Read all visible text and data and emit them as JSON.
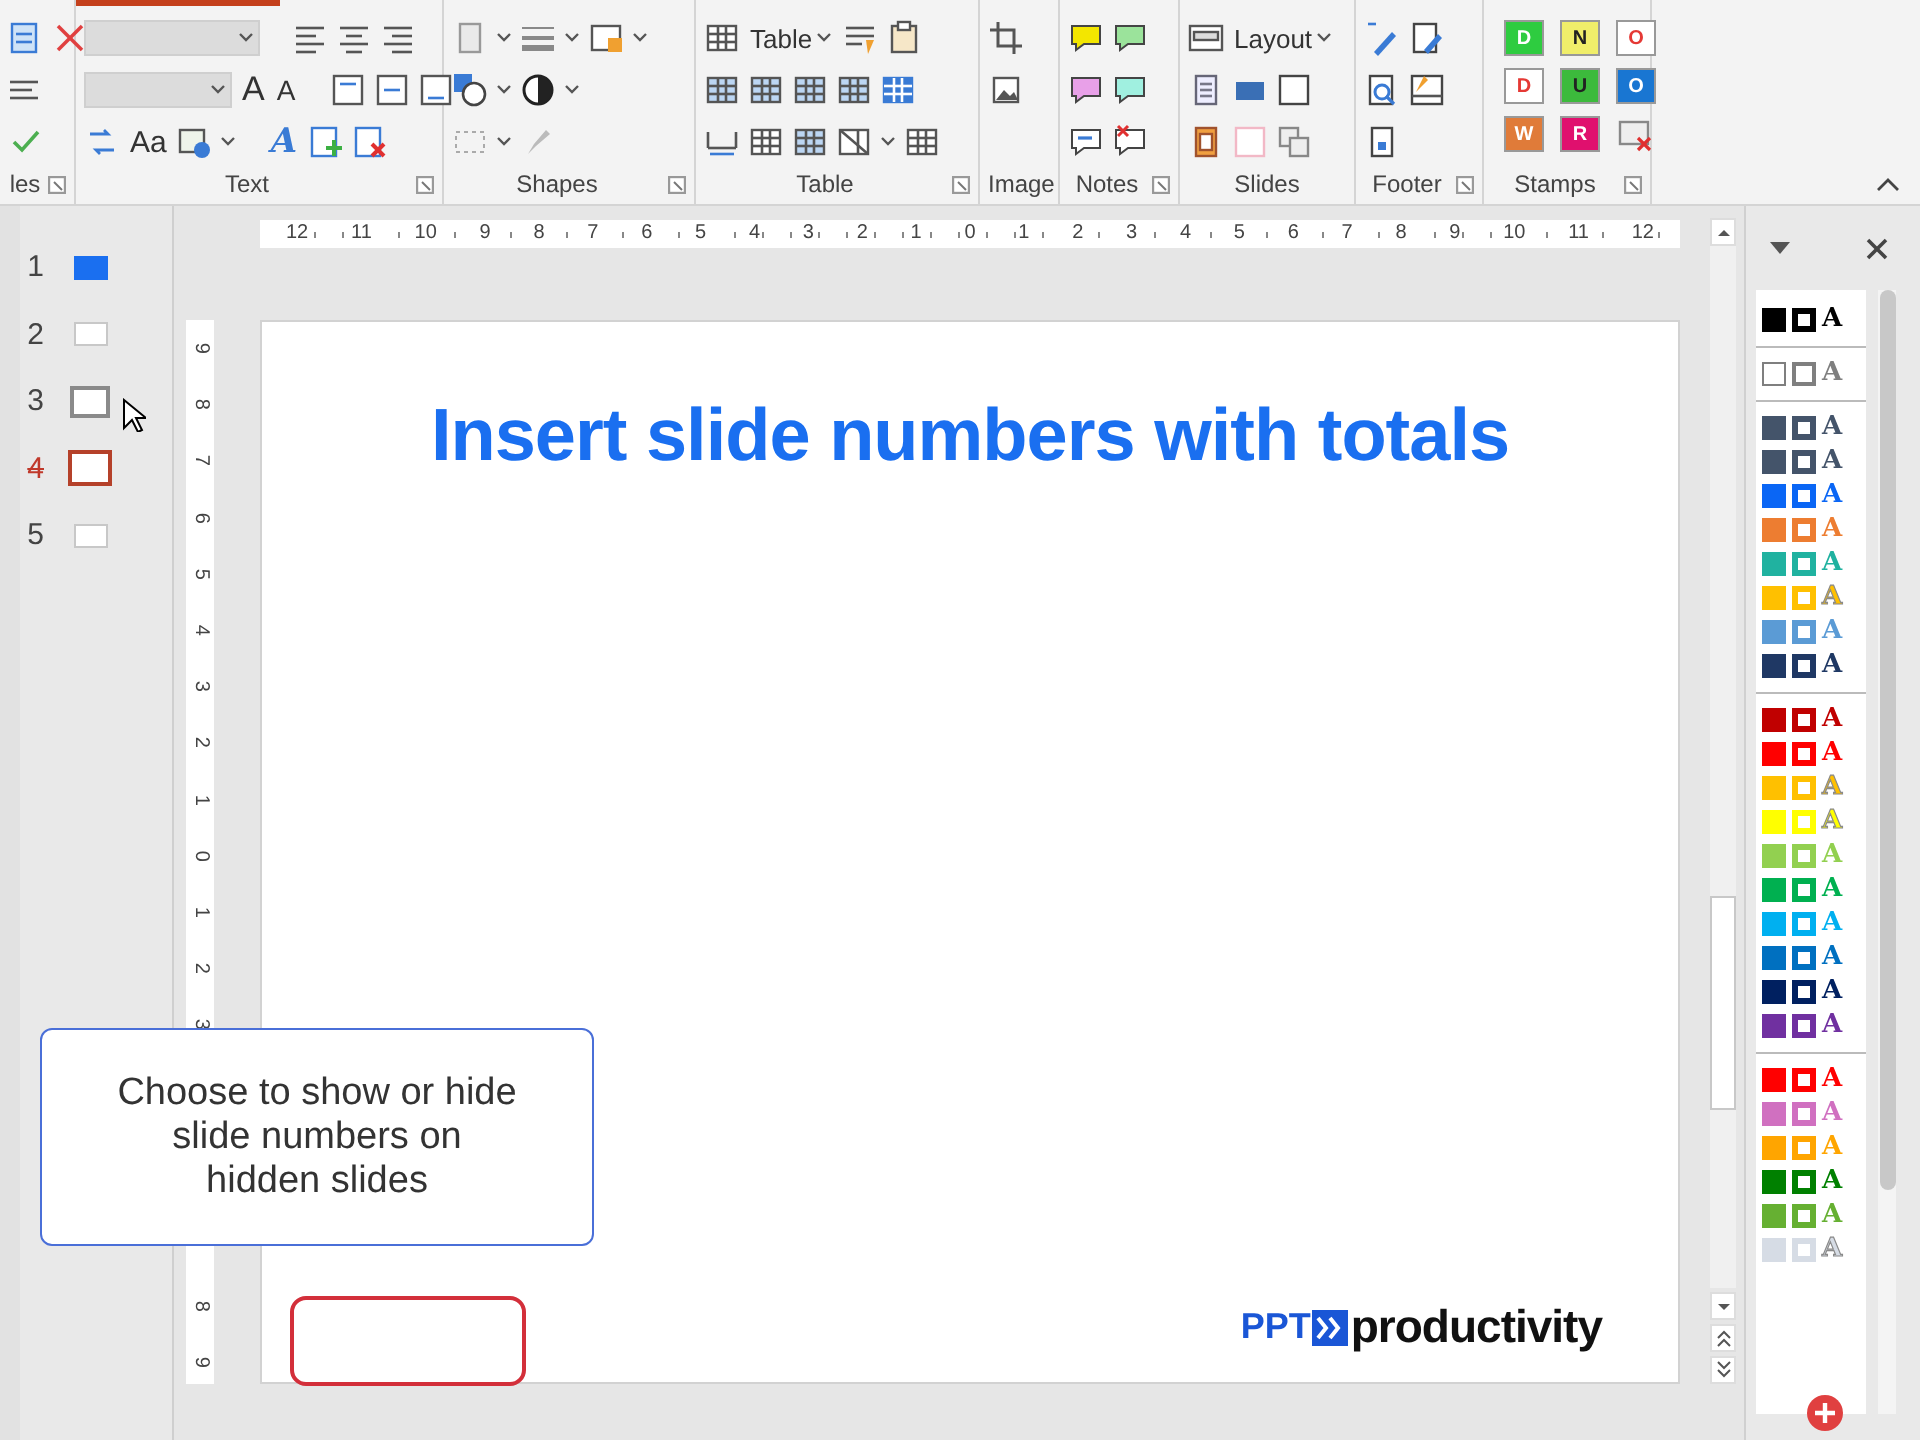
{
  "ribbon": {
    "groups": [
      {
        "kind": "styles",
        "title": "les",
        "launcher": true
      },
      {
        "kind": "text",
        "title": "Text",
        "launcher": true,
        "fields": [
          {
            "kind": "font",
            "disabled": true
          },
          {
            "kind": "size",
            "disabled": true
          }
        ],
        "labels": [
          {
            "text": "A",
            "kind": "grow"
          },
          {
            "text": "A",
            "kind": "shrink"
          },
          {
            "text": "Aa",
            "kind": "case"
          },
          {
            "text": "A",
            "kind": "effect"
          }
        ]
      },
      {
        "kind": "shapes",
        "title": "Shapes",
        "launcher": true
      },
      {
        "kind": "table",
        "title": "Table",
        "launcher": true,
        "labels": [
          {
            "text": "Table",
            "kind": "table"
          }
        ]
      },
      {
        "kind": "image",
        "title": "Image",
        "launcher": false
      },
      {
        "kind": "notes",
        "title": "Notes",
        "launcher": true
      },
      {
        "kind": "slides",
        "title": "Slides",
        "launcher": false,
        "labels": [
          {
            "text": "Layout",
            "kind": "layout"
          }
        ]
      },
      {
        "kind": "footer",
        "title": "Footer",
        "launcher": true
      },
      {
        "kind": "stamps",
        "title": "Stamps",
        "launcher": true,
        "stamps": [
          {
            "letter": "D",
            "color": "#2ecc40",
            "kind": "filled"
          },
          {
            "letter": "N",
            "color": "#f0ee6a",
            "kind": "light"
          },
          {
            "letter": "O",
            "color": "#e53935",
            "kind": "outline"
          },
          {
            "letter": "D",
            "color": "#e53935",
            "kind": "outline"
          },
          {
            "letter": "U",
            "color": "#3cba3c",
            "kind": "light"
          },
          {
            "letter": "O",
            "color": "#1976d2",
            "kind": "filled"
          },
          {
            "letter": "W",
            "color": "#e07b39",
            "kind": "filled"
          },
          {
            "letter": "R",
            "color": "#e0106e",
            "kind": "filled"
          }
        ]
      }
    ]
  },
  "thumbnails": [
    {
      "number": "1",
      "kind": "title",
      "selected": false,
      "hidden": false,
      "hovered": false
    },
    {
      "number": "2",
      "kind": "blank",
      "selected": false,
      "hidden": false,
      "hovered": false
    },
    {
      "number": "3",
      "kind": "blank",
      "selected": false,
      "hidden": false,
      "hovered": true
    },
    {
      "number": "4",
      "kind": "blank",
      "selected": true,
      "hidden": true,
      "hovered": false
    },
    {
      "number": "5",
      "kind": "blank",
      "selected": false,
      "hidden": false,
      "hovered": false
    }
  ],
  "rulers": {
    "horizontal": [
      "12",
      "11",
      "10",
      "9",
      "8",
      "7",
      "6",
      "5",
      "4",
      "3",
      "2",
      "1",
      "0",
      "1",
      "2",
      "3",
      "4",
      "5",
      "6",
      "7",
      "8",
      "9",
      "10",
      "11",
      "12"
    ],
    "vertical": [
      [
        "9",
        "8",
        "7",
        "6",
        "5",
        "4",
        "3",
        "2",
        "1",
        "0",
        "1",
        "2",
        "3"
      ],
      [
        "8",
        "9"
      ]
    ]
  },
  "slide": {
    "title": "Insert slide numbers with totals",
    "logo": {
      "prefix": "PPT",
      "name": "productivity"
    }
  },
  "callout": {
    "text": "Choose to show or hide\nslide numbers on\nhidden slides"
  },
  "color_panel": {
    "rows": [
      {
        "kind": "swatch",
        "color": "#000000",
        "letter": "A"
      },
      {
        "kind": "divider"
      },
      {
        "kind": "outline",
        "color": "#7f7f7f",
        "letter": "A"
      },
      {
        "kind": "divider"
      },
      {
        "kind": "swatch",
        "color": "#44546a",
        "letter": "A"
      },
      {
        "kind": "swatch",
        "color": "#44546a",
        "letter": "A"
      },
      {
        "kind": "swatch",
        "color": "#0a66f5",
        "letter": "A"
      },
      {
        "kind": "swatch",
        "color": "#ed7d31",
        "letter": "A"
      },
      {
        "kind": "swatch",
        "color": "#20b2a0",
        "letter": "A"
      },
      {
        "kind": "swatch",
        "color": "#ffc000",
        "letter": "A"
      },
      {
        "kind": "swatch",
        "color": "#5b9bd5",
        "letter": "A"
      },
      {
        "kind": "swatch",
        "color": "#1f3864",
        "letter": "A"
      },
      {
        "kind": "divider"
      },
      {
        "kind": "swatch",
        "color": "#c00000",
        "letter": "A"
      },
      {
        "kind": "swatch",
        "color": "#ff0000",
        "letter": "A"
      },
      {
        "kind": "swatch",
        "color": "#ffc000",
        "letter": "A"
      },
      {
        "kind": "swatch",
        "color": "#ffff00",
        "letter": "A"
      },
      {
        "kind": "swatch",
        "color": "#92d050",
        "letter": "A"
      },
      {
        "kind": "swatch",
        "color": "#00b050",
        "letter": "A"
      },
      {
        "kind": "swatch",
        "color": "#00b0f0",
        "letter": "A"
      },
      {
        "kind": "swatch",
        "color": "#0070c0",
        "letter": "A"
      },
      {
        "kind": "swatch",
        "color": "#002060",
        "letter": "A"
      },
      {
        "kind": "swatch",
        "color": "#7030a0",
        "letter": "A"
      },
      {
        "kind": "divider"
      },
      {
        "kind": "swatch",
        "color": "#ff0000",
        "letter": "A"
      },
      {
        "kind": "swatch",
        "color": "#d070c0",
        "letter": "A"
      },
      {
        "kind": "swatch",
        "color": "#ffa500",
        "letter": "A"
      },
      {
        "kind": "swatch",
        "color": "#008000",
        "letter": "A"
      },
      {
        "kind": "swatch",
        "color": "#66b032",
        "letter": "A"
      },
      {
        "kind": "swatch",
        "color": "#d6dce5",
        "letter": "A"
      }
    ]
  }
}
